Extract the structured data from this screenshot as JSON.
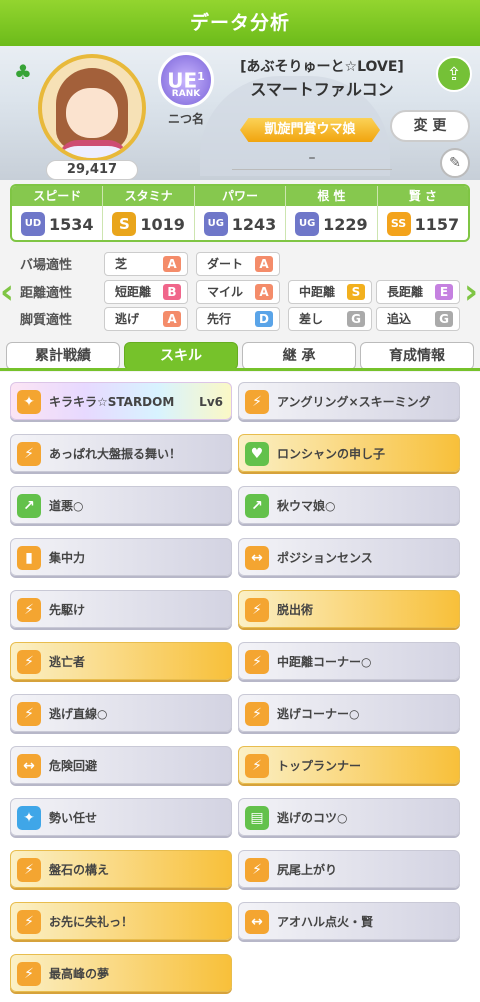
{
  "header": {
    "title": "データ分析"
  },
  "profile": {
    "fans": "29,417",
    "rank_letters": "UE",
    "rank_digit": "1",
    "rank_label": "RANK",
    "rank_name": "ニつ名",
    "title": "[あぶそりゅーと☆LOVE]",
    "name": "スマートファルコン",
    "epithet": "凱旋門賞ウマ娘",
    "change_label": "変 更",
    "memo": "–"
  },
  "stats": [
    {
      "label": "スピード",
      "grade": "UD",
      "value": "1534"
    },
    {
      "label": "スタミナ",
      "grade": "S",
      "value": "1019"
    },
    {
      "label": "パワー",
      "grade": "UG",
      "value": "1243"
    },
    {
      "label": "根 性",
      "grade": "UG",
      "value": "1229"
    },
    {
      "label": "賢 さ",
      "grade": "SS",
      "value": "1157"
    }
  ],
  "aptitude": {
    "track_label": "バ場適性",
    "track": [
      {
        "name": "芝",
        "grade": "A"
      },
      {
        "name": "ダート",
        "grade": "A"
      }
    ],
    "distance_label": "距離適性",
    "distance": [
      {
        "name": "短距離",
        "grade": "B"
      },
      {
        "name": "マイル",
        "grade": "A"
      },
      {
        "name": "中距離",
        "grade": "S"
      },
      {
        "name": "長距離",
        "grade": "E"
      }
    ],
    "style_label": "脚質適性",
    "style": [
      {
        "name": "逃げ",
        "grade": "A"
      },
      {
        "name": "先行",
        "grade": "D"
      },
      {
        "name": "差し",
        "grade": "G"
      },
      {
        "name": "追込",
        "grade": "G"
      }
    ]
  },
  "tabs": [
    "累計戦績",
    "スキル",
    "継 承",
    "育成情報"
  ],
  "skills": [
    {
      "name": "キラキラ☆STARDOM",
      "level": "Lv6"
    },
    {
      "name": "アングリング×スキーミング"
    },
    {
      "name": "あっぱれ大盤振る舞い！"
    },
    {
      "name": "ロンシャンの申し子"
    },
    {
      "name": "道悪○"
    },
    {
      "name": "秋ウマ娘○"
    },
    {
      "name": "集中力"
    },
    {
      "name": "ポジションセンス"
    },
    {
      "name": "先駆け"
    },
    {
      "name": "脱出術"
    },
    {
      "name": "逃亡者"
    },
    {
      "name": "中距離コーナー○"
    },
    {
      "name": "逃げ直線○"
    },
    {
      "name": "逃げコーナー○"
    },
    {
      "name": "危険回避"
    },
    {
      "name": "トップランナー"
    },
    {
      "name": "勢い任せ"
    },
    {
      "name": "逃げのコツ○"
    },
    {
      "name": "盤石の構え"
    },
    {
      "name": "尻尾上がり"
    },
    {
      "name": "お先に失礼っ！"
    },
    {
      "name": "アオハル点火・賢"
    },
    {
      "name": "最高峰の夢"
    }
  ]
}
